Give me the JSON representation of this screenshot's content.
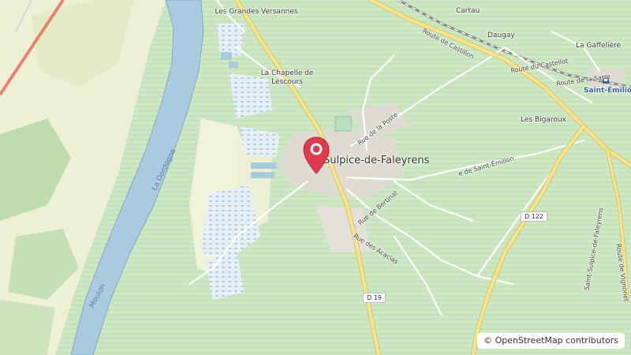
{
  "map": {
    "place_name": "Saint-Sulpice-de-Faleyrens",
    "labels": {
      "grandes_versannes": "Les Grandes Versannes",
      "chapelle": "La Chapelle de Lescours",
      "cartau": "Cartau",
      "daugay": "Daugay",
      "gaffeliere": "La Gaffelière",
      "saint_emilion": "Saint-Émilion",
      "bigaroux": "Les Bigaroux",
      "dordogne": "La Dordogne",
      "moulon": "Moulon",
      "village": "Sulpice-de-Faleyrens"
    },
    "roads": {
      "castillon": "Route de Castillon",
      "castellot": "Route du Castellot",
      "sarre": "Route de la Sarre",
      "poste": "Rue de la Poste",
      "saint_emilion": "e de Saint-Émilion",
      "bertinat": "Rue de Bertinat",
      "acacias": "Rue des Acacias",
      "d122": "D 122",
      "d19": "D 19",
      "st_sulpice": "Saint-Sulpice-de-Faleyrens",
      "vignonet": "Route de Vignonet",
      "ge": "Ge"
    },
    "attribution": "© OpenStreetMap contributors",
    "colors": {
      "vineyard": "#cfe8c4",
      "farmland": "#eef0d5",
      "water": "#a9cbe0",
      "river_stroke": "#7fa8cc",
      "road_major": "#f6e58d",
      "road_minor": "#ffffff",
      "pin": "#e03a4e",
      "rail": "#8a8a8a",
      "trunk": "#e8826e"
    },
    "icons": {
      "marker": "map-pin-icon",
      "station": "train-station-icon"
    }
  }
}
